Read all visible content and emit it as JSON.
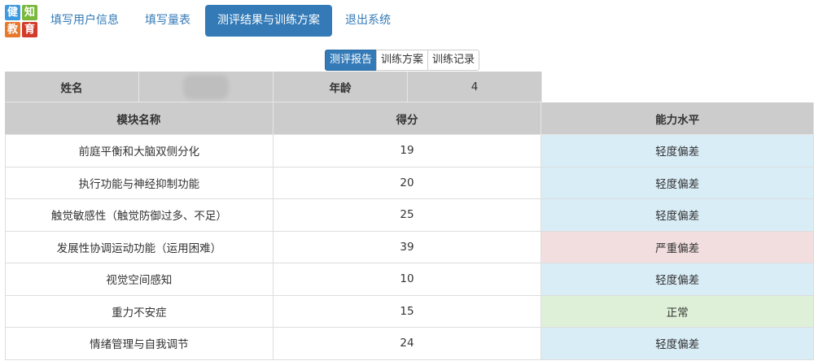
{
  "logo": {
    "chars": [
      "健",
      "知",
      "教",
      "育"
    ]
  },
  "nav": {
    "items": [
      {
        "label": "填写用户信息"
      },
      {
        "label": "填写量表"
      },
      {
        "label": "测评结果与训练方案"
      },
      {
        "label": "退出系统"
      }
    ],
    "active_index": 2
  },
  "subtabs": {
    "items": [
      {
        "label": "测评报告"
      },
      {
        "label": "训练方案"
      },
      {
        "label": "训练记录"
      }
    ],
    "active_index": 0
  },
  "info": {
    "name_label": "姓名",
    "name_value": "",
    "age_label": "年龄",
    "age_value": "4"
  },
  "table": {
    "headers": [
      "模块名称",
      "得分",
      "能力水平"
    ],
    "rows": [
      {
        "module": "前庭平衡和大脑双侧分化",
        "score": "19",
        "level": "轻度偏差",
        "status": "mild"
      },
      {
        "module": "执行功能与神经抑制功能",
        "score": "20",
        "level": "轻度偏差",
        "status": "mild"
      },
      {
        "module": "触觉敏感性（触觉防御过多、不足）",
        "score": "25",
        "level": "轻度偏差",
        "status": "mild"
      },
      {
        "module": "发展性协调运动功能（运用困难）",
        "score": "39",
        "level": "严重偏差",
        "status": "severe"
      },
      {
        "module": "视觉空间感知",
        "score": "10",
        "level": "轻度偏差",
        "status": "mild"
      },
      {
        "module": "重力不安症",
        "score": "15",
        "level": "正常",
        "status": "normal"
      },
      {
        "module": "情绪管理与自我调节",
        "score": "24",
        "level": "轻度偏差",
        "status": "mild"
      }
    ]
  },
  "colors": {
    "accent": "#337ab7",
    "mild": "#d9edf7",
    "severe": "#f2dede",
    "normal": "#dff0d8",
    "header_bg": "#cccccc"
  }
}
